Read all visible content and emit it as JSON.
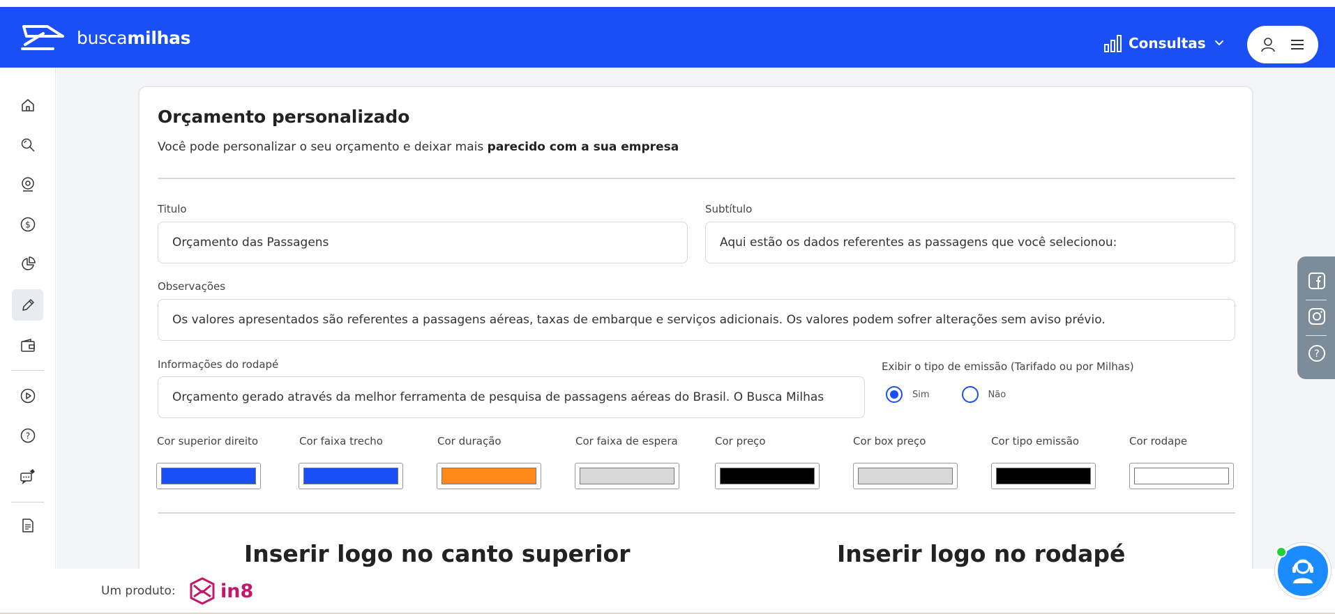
{
  "brand": {
    "name_light": "busca",
    "name_bold": "milhas",
    "primary_color": "#1a4ff5"
  },
  "header": {
    "menu_label": "Consultas"
  },
  "sidebar": {
    "items": [
      {
        "icon": "home-icon"
      },
      {
        "icon": "search-icon"
      },
      {
        "icon": "location-icon"
      },
      {
        "icon": "dollar-icon"
      },
      {
        "icon": "pie-chart-icon"
      },
      {
        "icon": "pencil-icon",
        "active": true
      },
      {
        "icon": "wallet-icon"
      },
      {
        "icon": "play-icon"
      },
      {
        "icon": "help-icon"
      },
      {
        "icon": "chat-icon"
      },
      {
        "icon": "document-icon"
      }
    ]
  },
  "card": {
    "title": "Orçamento personalizado",
    "subtitle_plain": "Você pode personalizar o seu orçamento e deixar mais ",
    "subtitle_bold": "parecido com a sua empresa"
  },
  "form": {
    "titulo_label": "Titulo",
    "titulo_value": "Orçamento das Passagens",
    "subtitulo_label": "Subtítulo",
    "subtitulo_value": "Aqui estão os dados referentes as passagens que você selecionou:",
    "observacoes_label": "Observações",
    "observacoes_value": "Os valores apresentados são referentes a passagens aéreas, taxas de embarque e serviços adicionais. Os valores podem sofrer alterações sem aviso prévio.",
    "rodape_label": "Informações do rodapé",
    "rodape_value": "Orçamento gerado através da melhor ferramenta de pesquisa de passagens aéreas do Brasil. O Busca Milhas",
    "emissao_label": "Exibir o tipo de emissão (Tarifado ou por Milhas)",
    "radio_sim": "Sim",
    "radio_nao": "Não",
    "radio_selected": "Sim"
  },
  "colors": [
    {
      "label": "Cor superior direito",
      "value": "#1a4ff5"
    },
    {
      "label": "Cor faixa trecho",
      "value": "#1a4ff5"
    },
    {
      "label": "Cor duração",
      "value": "#ff8a1a"
    },
    {
      "label": "Cor faixa de espera",
      "value": "#d9d9d9"
    },
    {
      "label": "Cor preço",
      "value": "#000000"
    },
    {
      "label": "Cor box preço",
      "value": "#d9d9d9"
    },
    {
      "label": "Cor tipo emissão",
      "value": "#000000"
    },
    {
      "label": "Cor rodape",
      "value": "#ffffff"
    }
  ],
  "logo_sections": {
    "top": "Inserir logo no canto superior",
    "footer": "Inserir logo no rodapé"
  },
  "footer": {
    "label": "Um produto:",
    "brand": "in8"
  }
}
